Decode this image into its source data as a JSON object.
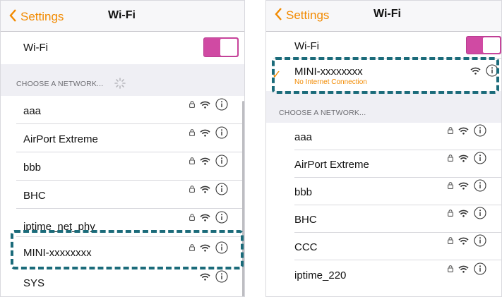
{
  "left": {
    "back_label": "Settings",
    "title": "Wi-Fi",
    "wifi_label": "Wi-Fi",
    "wifi_on": true,
    "section_header": "CHOOSE A NETWORK...",
    "networks": [
      {
        "name": "aaa",
        "secured": true
      },
      {
        "name": "AirPort Extreme",
        "secured": true
      },
      {
        "name": "bbb",
        "secured": true
      },
      {
        "name": "BHC",
        "secured": true
      },
      {
        "name": "iptime_net_phy",
        "secured": true
      },
      {
        "name": "MINI-xxxxxxxx",
        "secured": true,
        "highlighted": true
      },
      {
        "name": "SYS",
        "secured": false
      }
    ]
  },
  "right": {
    "back_label": "Settings",
    "title": "Wi-Fi",
    "wifi_label": "Wi-Fi",
    "wifi_on": true,
    "connected": {
      "name": "MINI-xxxxxxxx",
      "status": "No Internet Connection",
      "checkmark": "✓"
    },
    "section_header": "CHOOSE A NETWORK...",
    "networks": [
      {
        "name": "aaa",
        "secured": true
      },
      {
        "name": "AirPort Extreme",
        "secured": true
      },
      {
        "name": "bbb",
        "secured": true
      },
      {
        "name": "BHC",
        "secured": true
      },
      {
        "name": "CCC",
        "secured": true
      },
      {
        "name": "iptime_220",
        "secured": true
      }
    ]
  },
  "colors": {
    "accent": "#f28a00",
    "toggle_on": "#d04aa3",
    "highlight_border": "#1b6b7a",
    "background": "#efeff4"
  },
  "icons": [
    "chevron-left-icon",
    "lock-icon",
    "wifi-icon",
    "info-icon",
    "spinner-icon",
    "checkmark-icon"
  ]
}
